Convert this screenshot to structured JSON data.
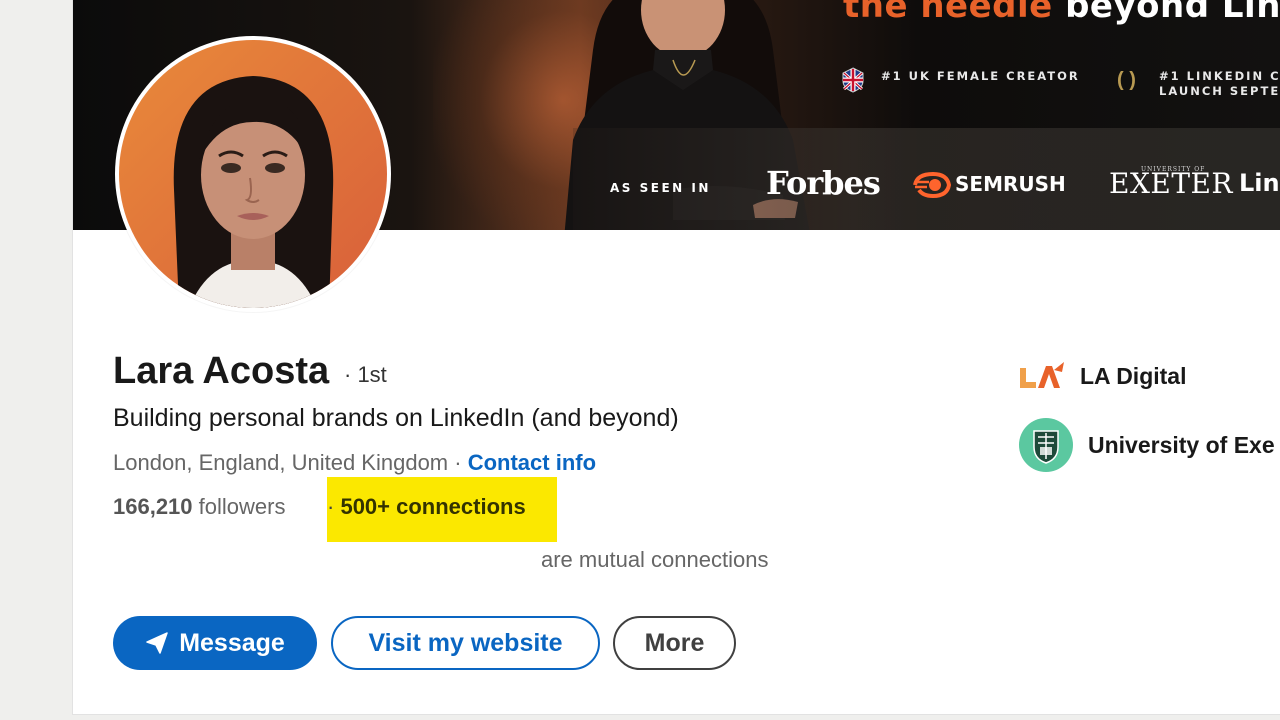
{
  "banner": {
    "headline_orange": "the needle",
    "headline_white": "beyond Link",
    "tag1": "#1 UK FEMALE CREATOR",
    "tag2_line1": "#1 LINKEDIN C",
    "tag2_line2": "LAUNCH SEPTE",
    "as_seen_in": "AS SEEN IN",
    "logo_forbes": "Forbes",
    "logo_semrush": "SEMRUSH",
    "logo_exeter_small": "UNIVERSITY OF",
    "logo_exeter": "EXETER",
    "logo_link": "Link"
  },
  "profile": {
    "name": "Lara Acosta",
    "degree": "· 1st",
    "tagline": "Building personal brands on LinkedIn (and beyond)",
    "location": "London, England, United Kingdom",
    "separator": " · ",
    "contact_info": "Contact info",
    "followers_count": "166,210",
    "followers_label": " followers",
    "connections_sep": "· ",
    "connections": "500+ connections",
    "mutual": "are mutual connections",
    "highlight_color": "#fbe800"
  },
  "actions": {
    "message": "Message",
    "message_icon": "send-icon",
    "website": "Visit my website",
    "more": "More"
  },
  "sidebar": {
    "company": "LA Digital",
    "school": "University of Exe"
  },
  "colors": {
    "brand_blue": "#0a66c2",
    "banner_orange": "#e8622a"
  }
}
